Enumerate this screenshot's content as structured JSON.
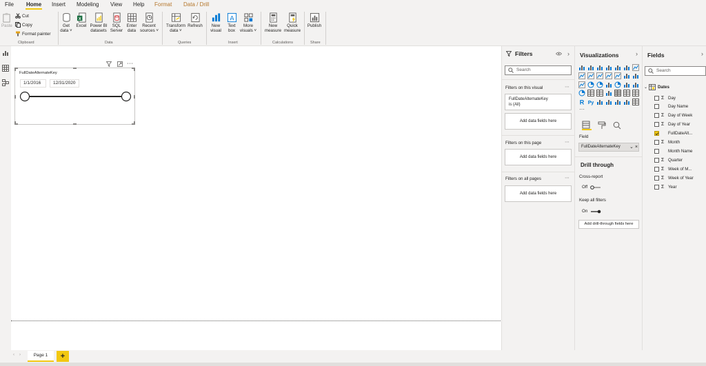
{
  "menu": {
    "tabs": [
      "File",
      "Home",
      "Insert",
      "Modeling",
      "View",
      "Help",
      "Format",
      "Data / Drill"
    ],
    "active": "Home"
  },
  "ribbon": {
    "clipboard": {
      "paste": "Paste",
      "cut": "Cut",
      "copy": "Copy",
      "format_painter": "Format painter",
      "label": "Clipboard"
    },
    "data": {
      "buttons": [
        {
          "line1": "Get",
          "line2": "data ˅"
        },
        {
          "line1": "Excel",
          "line2": ""
        },
        {
          "line1": "Power BI",
          "line2": "datasets"
        },
        {
          "line1": "SQL",
          "line2": "Server"
        },
        {
          "line1": "Enter",
          "line2": "data"
        },
        {
          "line1": "Recent",
          "line2": "sources ˅"
        }
      ],
      "label": "Data"
    },
    "queries": {
      "buttons": [
        {
          "line1": "Transform",
          "line2": "data ˅"
        },
        {
          "line1": "Refresh",
          "line2": ""
        }
      ],
      "label": "Queries"
    },
    "insert": {
      "buttons": [
        {
          "line1": "New",
          "line2": "visual"
        },
        {
          "line1": "Text",
          "line2": "box"
        },
        {
          "line1": "More",
          "line2": "visuals ˅"
        }
      ],
      "label": "Insert"
    },
    "calculations": {
      "buttons": [
        {
          "line1": "New",
          "line2": "measure"
        },
        {
          "line1": "Quick",
          "line2": "measure"
        }
      ],
      "label": "Calculations"
    },
    "share": {
      "buttons": [
        {
          "line1": "Publish",
          "line2": ""
        }
      ],
      "label": "Share"
    }
  },
  "canvas": {
    "slicer": {
      "title": "FullDateAlternateKey",
      "start_date": "1/1/2016",
      "end_date": "12/31/2020"
    },
    "page_tab": "Page 1",
    "add_page": "+"
  },
  "filters_pane": {
    "title": "Filters",
    "search_placeholder": "Search",
    "on_visual_label": "Filters on this visual",
    "visual_filter_field": "FullDateAlternateKey",
    "visual_filter_value": "is (All)",
    "add_fields": "Add data fields here",
    "on_page_label": "Filters on this page",
    "on_all_pages_label": "Filters on all pages"
  },
  "viz_pane": {
    "title": "Visualizations",
    "field_label": "Field",
    "field_value": "FullDateAlternateKey",
    "drill_title": "Drill through",
    "cross_report_label": "Cross-report",
    "cross_report_state": "Off",
    "keep_filters_label": "Keep all filters",
    "keep_filters_state": "On",
    "add_drill_fields": "Add drill-through fields here",
    "r_label": "R",
    "py_label": "Py"
  },
  "fields_pane": {
    "title": "Fields",
    "search_placeholder": "Search",
    "table_name": "Dates",
    "fields": [
      {
        "name": "Day",
        "sigma": true,
        "checked": false
      },
      {
        "name": "Day Name",
        "sigma": false,
        "checked": false
      },
      {
        "name": "Day of Week",
        "sigma": true,
        "checked": false
      },
      {
        "name": "Day of Year",
        "sigma": true,
        "checked": false
      },
      {
        "name": "FullDateAlt...",
        "sigma": false,
        "checked": true
      },
      {
        "name": "Month",
        "sigma": true,
        "checked": false
      },
      {
        "name": "Month Name",
        "sigma": false,
        "checked": false
      },
      {
        "name": "Quarter",
        "sigma": true,
        "checked": false
      },
      {
        "name": "Week of M...",
        "sigma": true,
        "checked": false
      },
      {
        "name": "Week of Year",
        "sigma": true,
        "checked": false
      },
      {
        "name": "Year",
        "sigma": true,
        "checked": false
      }
    ]
  },
  "colors": {
    "accent": "#f2c811",
    "context_tab": "#b5762b",
    "chrome": "#f3f2f1",
    "canvas": "#ffffff"
  }
}
